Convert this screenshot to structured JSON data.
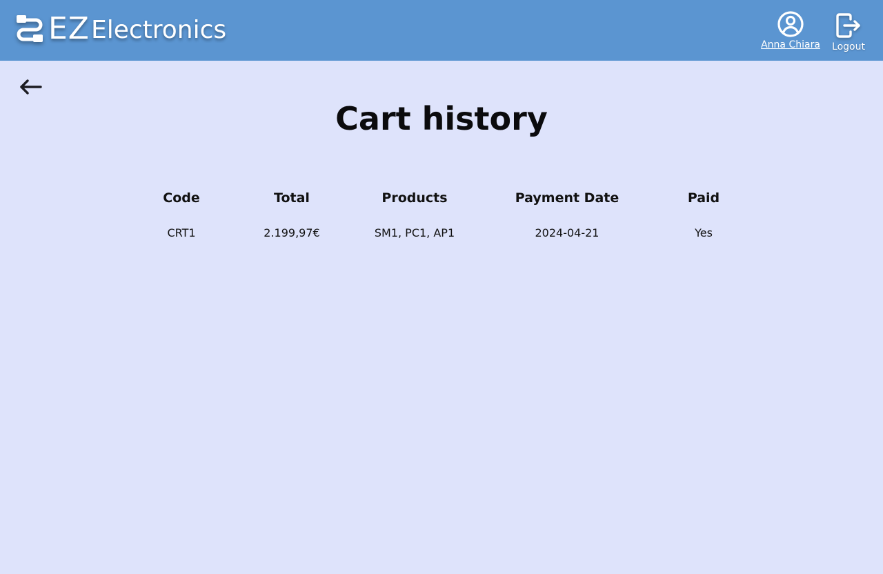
{
  "header": {
    "brand_ez": "EZ",
    "brand_rest": "Electronics",
    "user_name": "Anna Chiara",
    "logout_label": "Logout",
    "icons": {
      "logo": "cable-logo-icon",
      "user": "user-circle-icon",
      "logout": "logout-icon"
    },
    "color": "#5b95d1"
  },
  "page": {
    "title": "Cart history",
    "back_icon": "arrow-left-icon",
    "background": "#dee3fb"
  },
  "table": {
    "headers": {
      "code": "Code",
      "total": "Total",
      "products": "Products",
      "payment_date": "Payment Date",
      "paid": "Paid"
    },
    "rows": [
      {
        "code": "CRT1",
        "total": "2.199,97€",
        "products": "SM1, PC1, AP1",
        "payment_date": "2024-04-21",
        "paid": "Yes"
      }
    ]
  }
}
